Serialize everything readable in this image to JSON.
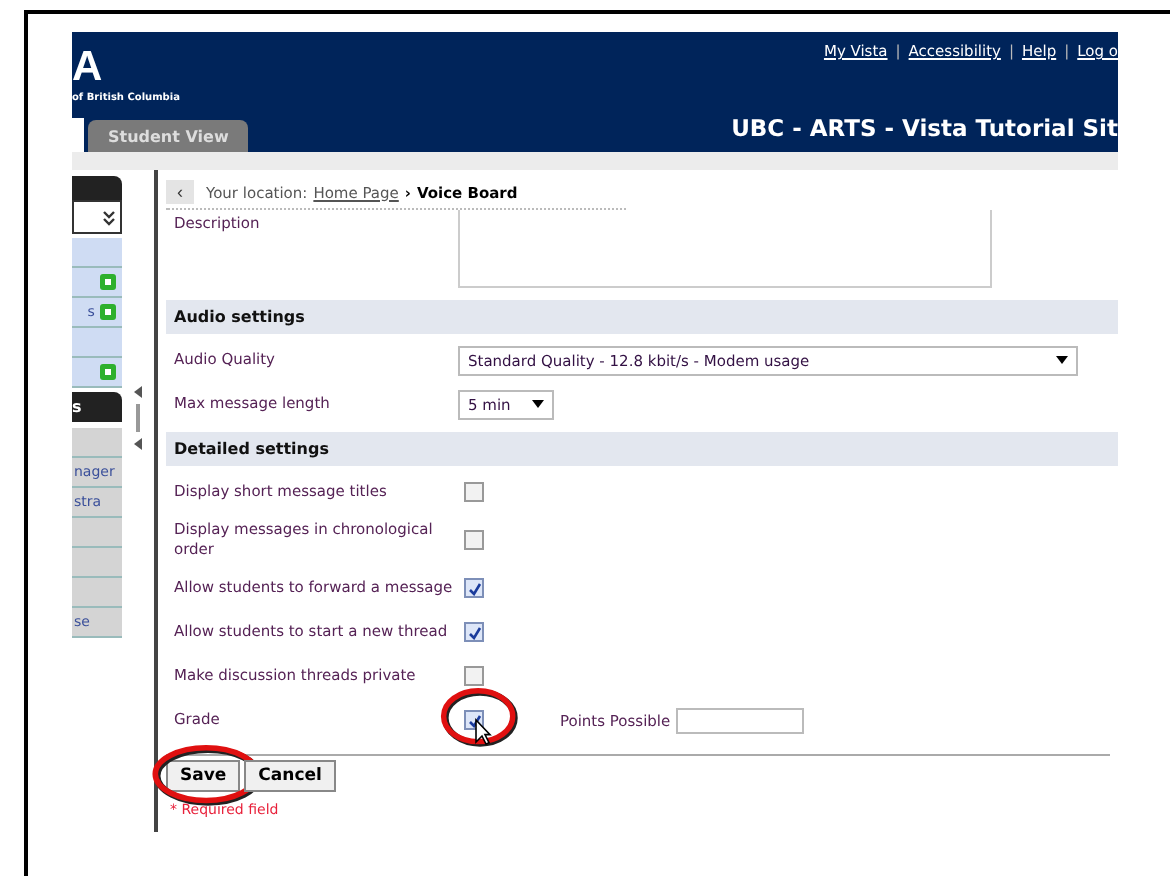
{
  "header": {
    "logo_letter": "A",
    "logo_subtitle": "of British Columbia",
    "links": [
      "My Vista",
      "Accessibility",
      "Help",
      "Log o"
    ],
    "link_separator": "|",
    "tabs": [
      {
        "label": "Student View",
        "selected": false
      }
    ],
    "site_title": "UBC - ARTS - Vista Tutorial Sit"
  },
  "sidebar": {
    "top_items": [
      {
        "icon": false
      },
      {
        "icon": true
      },
      {
        "label": "s",
        "icon": true
      },
      {
        "icon": false
      },
      {
        "icon": true
      }
    ],
    "header": "s",
    "bottom_items": [
      {
        "kind": "blank"
      },
      {
        "kind": "text",
        "label": "nager"
      },
      {
        "kind": "text",
        "label": "stra"
      },
      {
        "kind": "blank"
      },
      {
        "kind": "blank"
      },
      {
        "kind": "blank"
      },
      {
        "kind": "text",
        "label": "se"
      }
    ]
  },
  "breadcrumb": {
    "back": "‹",
    "prefix": "Your location:",
    "link": "Home Page",
    "separator": "›",
    "current": "Voice Board"
  },
  "description_label": "Description",
  "sections": [
    {
      "title": "Audio settings",
      "rows": [
        {
          "kind": "wide-select",
          "label": "Audio Quality",
          "value": "Standard Quality - 12.8 kbit/s - Modem usage"
        },
        {
          "kind": "select",
          "label": "Max message length",
          "value": "5 min"
        }
      ]
    },
    {
      "title": "Detailed settings",
      "rows": [
        {
          "kind": "checkbox",
          "label": "Display short message titles",
          "checked": false,
          "circled": false
        },
        {
          "kind": "checkbox",
          "label": "Display messages in chronological order",
          "checked": false,
          "circled": false
        },
        {
          "kind": "checkbox",
          "label": "Allow students to forward a message",
          "checked": true,
          "circled": false
        },
        {
          "kind": "checkbox",
          "label": "Allow students to start a new thread",
          "checked": true,
          "circled": false
        },
        {
          "kind": "checkbox",
          "label": "Make discussion threads private",
          "checked": false,
          "circled": false
        },
        {
          "kind": "checkbox",
          "label": "Grade",
          "checked": true,
          "circled": true,
          "extra_label": "Points Possible"
        }
      ]
    }
  ],
  "buttons": [
    {
      "label": "Save",
      "circled": true
    },
    {
      "label": "Cancel",
      "circled": false
    }
  ],
  "required_note": "* Required field"
}
